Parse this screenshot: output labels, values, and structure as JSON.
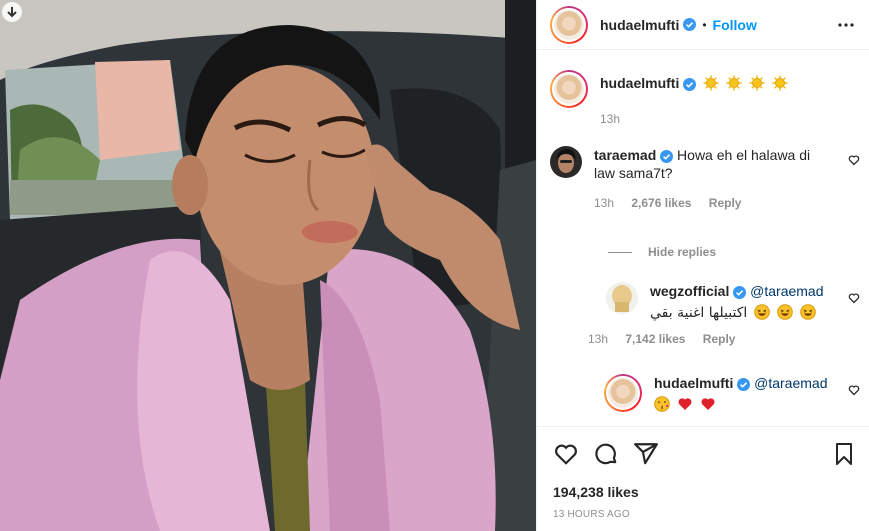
{
  "post": {
    "author": "hudaelmufti",
    "follow_label": "Follow",
    "separator": "•",
    "caption_user": "hudaelmufti",
    "caption_emojis": [
      "sun",
      "sun",
      "sun",
      "sun"
    ],
    "caption_time": "13h"
  },
  "comments": [
    {
      "user": "taraemad",
      "text": "Howa eh el halawa di law sama7t?",
      "time": "13h",
      "likes": "2,676 likes",
      "reply_label": "Reply"
    }
  ],
  "hide_replies_label": "Hide replies",
  "replies": [
    {
      "user": "wegzofficial",
      "mention": "@taraemad",
      "text": "اكتبيلها اغنية بقي",
      "emojis": [
        "laughing",
        "laughing",
        "laughing"
      ],
      "time": "13h",
      "likes": "7,142 likes",
      "reply_label": "Reply"
    },
    {
      "user": "hudaelmufti",
      "mention": "@taraemad",
      "emojis": [
        "wink-kiss",
        "red-heart",
        "red-heart"
      ]
    }
  ],
  "footer": {
    "likes": "194,238 likes",
    "posted_ago": "13 HOURS AGO"
  },
  "colors": {
    "link_blue": "#0095f6",
    "verified_blue": "#3897f0",
    "muted": "#8e8e8e",
    "coat_pink": "#d9a0c8"
  }
}
